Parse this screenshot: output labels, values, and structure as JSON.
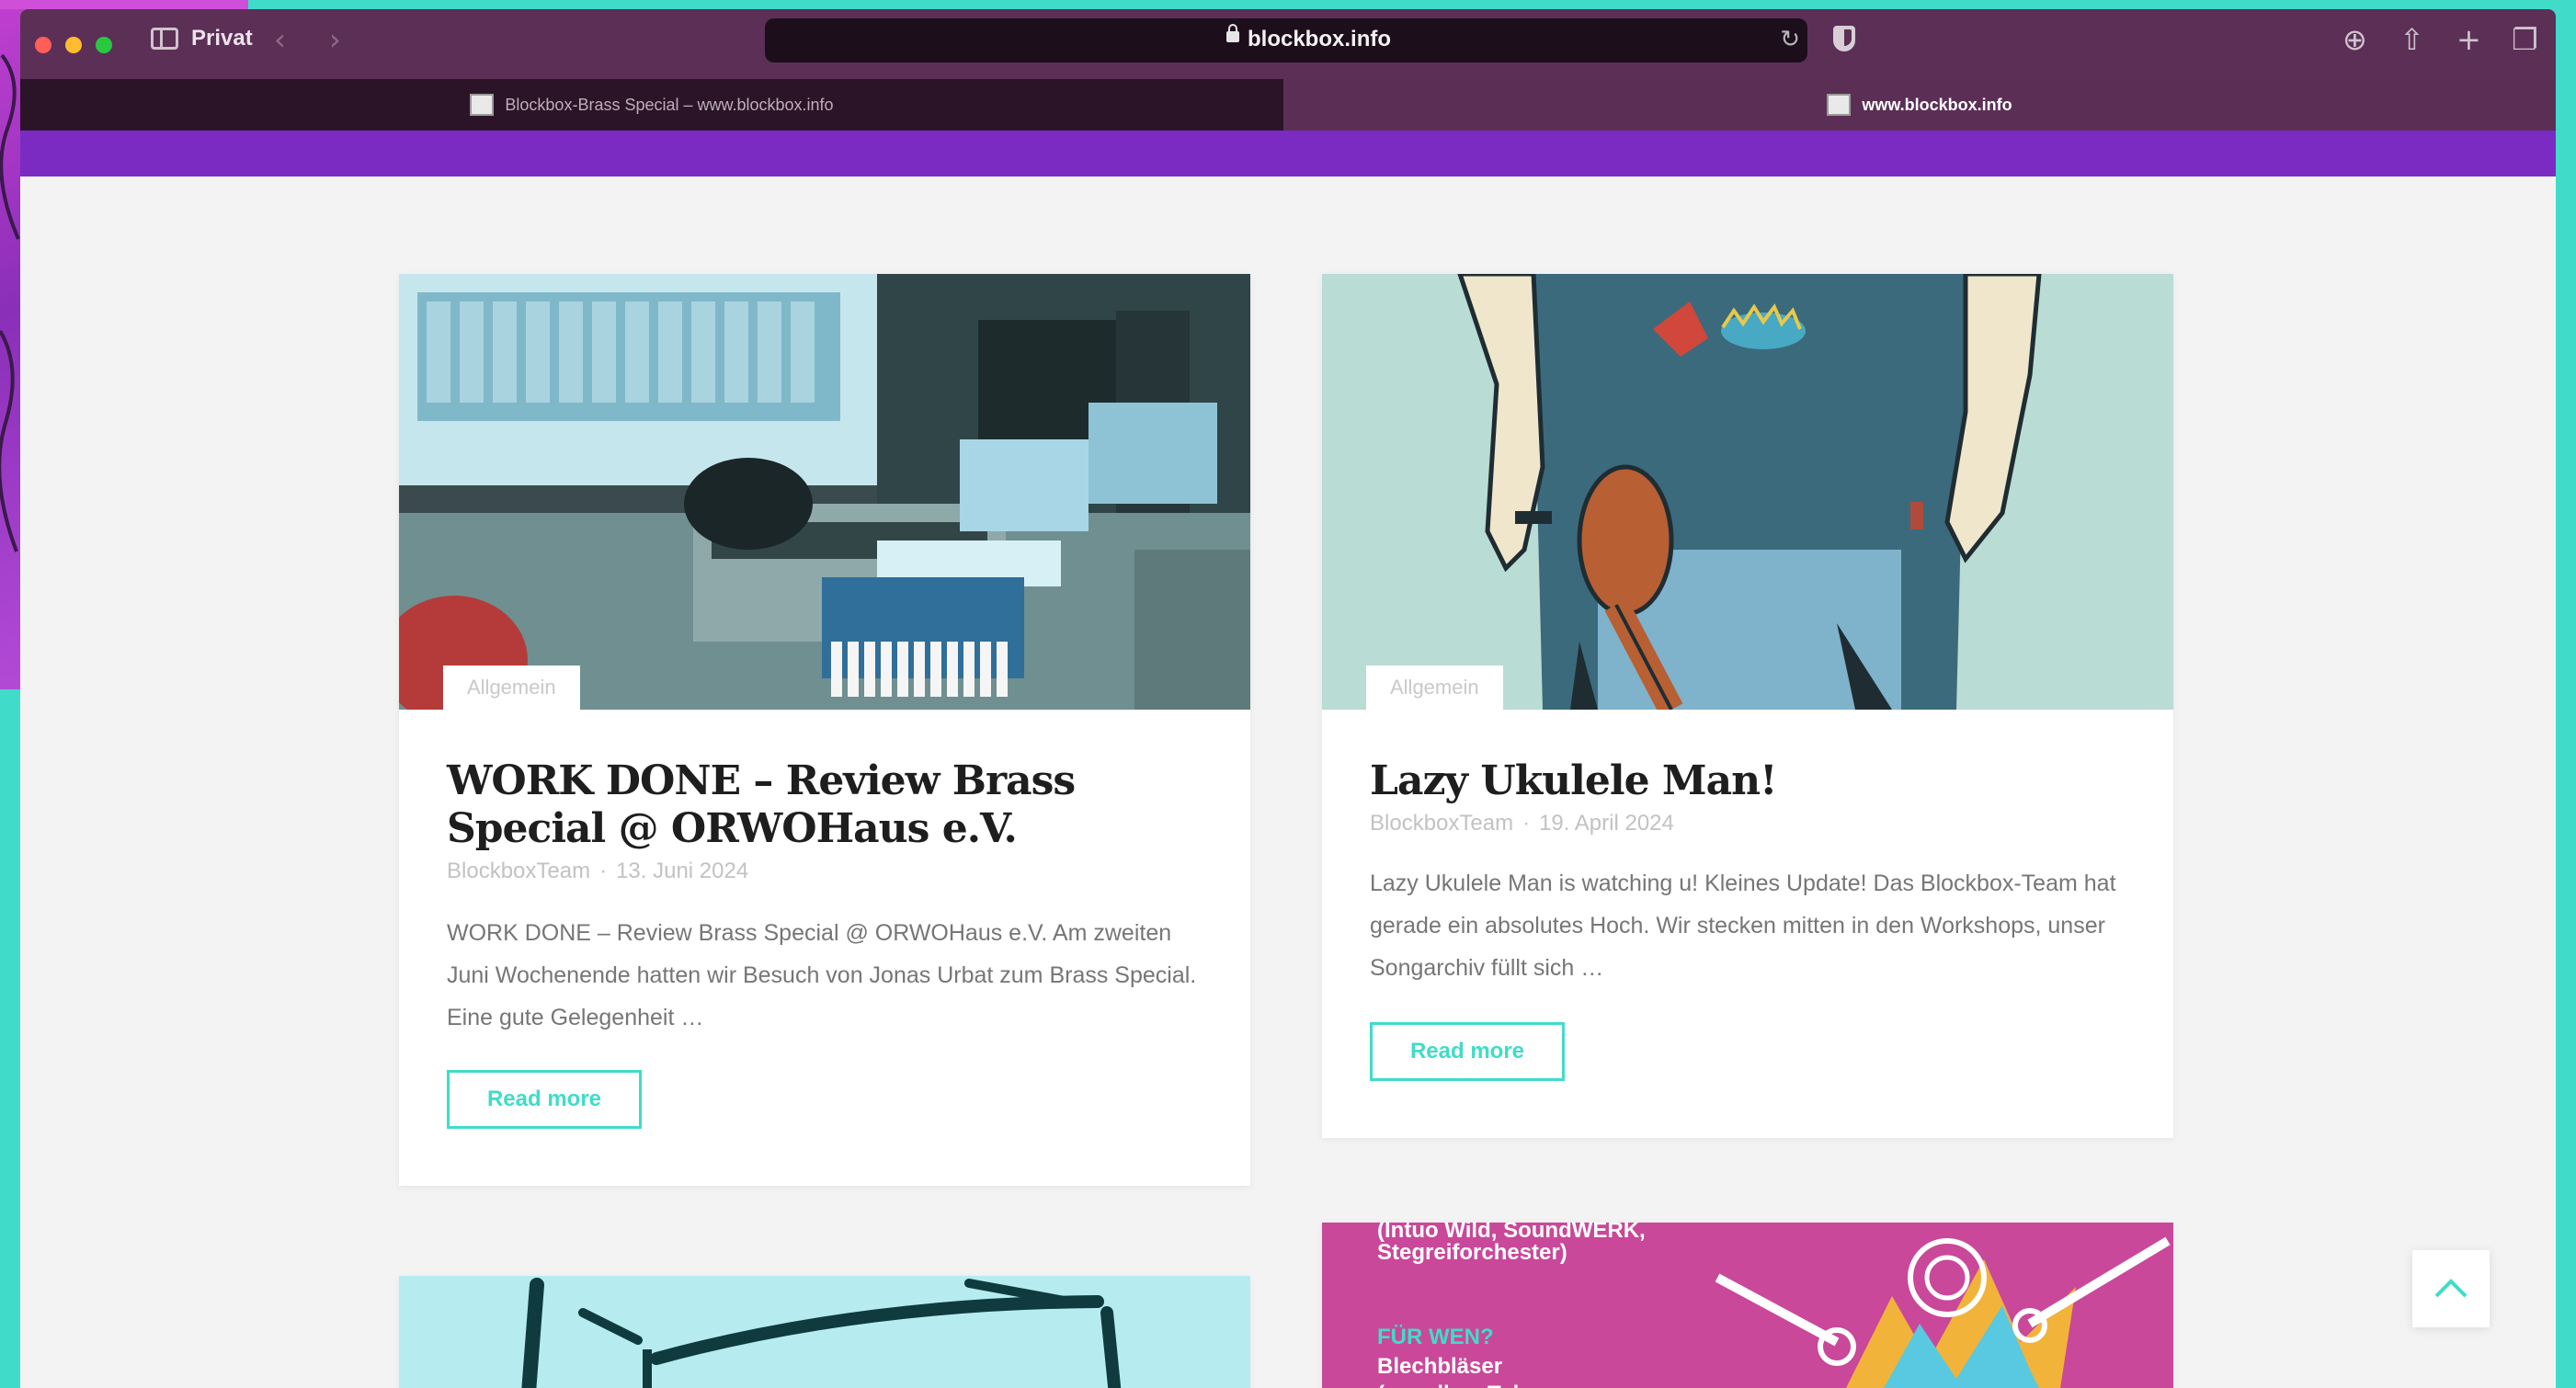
{
  "browser": {
    "profile_label": "Privat",
    "url": "blockbox.info",
    "tabs": [
      {
        "title": "Blockbox-Brass Special – www.blockbox.info",
        "active": false
      },
      {
        "title": "www.blockbox.info",
        "active": true
      }
    ]
  },
  "colors": {
    "accent": "#40dcc9",
    "brand_purple": "#7b2bc1",
    "toolbar": "#5c2f57"
  },
  "posts": [
    {
      "category": "Allgemein",
      "title": "WORK DONE – Review Brass Special @ ORWOHaus e.V.",
      "author": "BlockboxTeam",
      "separator": "·",
      "date": "13. Juni 2024",
      "excerpt": "WORK DONE – Review Brass Special @ ORWOHaus e.V. Am zweiten Juni Wochenende hatten wir Besuch von Jonas Urbat zum Brass Special. Eine gute Gelegenheit …",
      "read_more": "Read more"
    },
    {
      "category": "Allgemein",
      "title": "Lazy Ukulele Man!",
      "author": "BlockboxTeam",
      "separator": "·",
      "date": "19. April 2024",
      "excerpt": "Lazy Ukulele Man is watching u! Kleines Update! Das Blockbox-Team hat gerade ein absolutes Hoch. Wir stecken mitten in den Workshops, unser Songarchiv füllt sich …",
      "read_more": "Read more"
    }
  ],
  "poster": {
    "line1": "(Intuo Wild, SoundWERK,",
    "line2": "Stegreiforchester)",
    "heading": "FÜR WEN?",
    "line3": "Blechbläser",
    "line4": "(vor allem Tuba"
  },
  "icons": {
    "scroll_top": "chevron-up-icon",
    "download": "download-icon",
    "share": "share-icon",
    "new_tab": "plus-icon",
    "tab_overview": "tabs-overview-icon"
  }
}
